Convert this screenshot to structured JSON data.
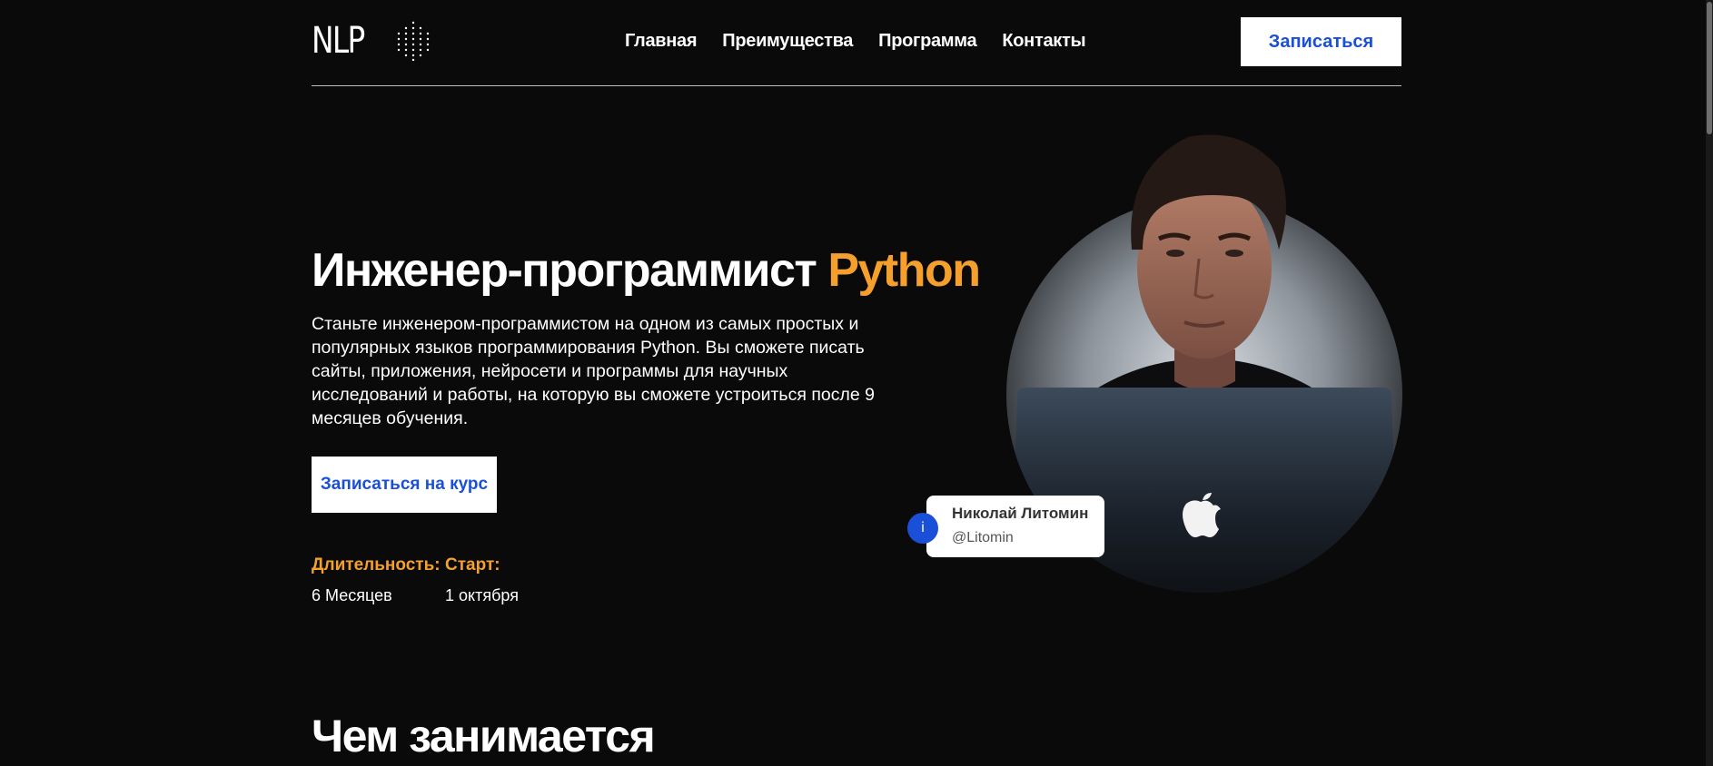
{
  "header": {
    "logo_text": "NLP",
    "nav": [
      "Главная",
      "Преимущества",
      "Программа",
      "Контакты"
    ],
    "cta_label": "Записаться"
  },
  "hero": {
    "title_main": "Инженер-программист ",
    "title_accent": "Python",
    "description": "Станьте инженером-программистом на одном из самых простых и популярных языков программирования Python. Вы сможете писать сайты, приложения, нейросети и программы для научных исследований и работы, на которую вы сможете устроиться после 9 месяцев обучения.",
    "cta_label": "Записаться на курс",
    "duration_label": "Длительность:",
    "duration_value": "6 Месяцев",
    "start_label": "Старт:",
    "start_value": "1 октября"
  },
  "author_card": {
    "name": "Николай Литомин",
    "handle": "@Litomin",
    "icon_glyph": "i"
  },
  "section": {
    "title": "Чем занимается"
  },
  "colors": {
    "background": "#0a0a0a",
    "accent_orange": "#f5a02c",
    "accent_blue": "#1a4fd8"
  }
}
